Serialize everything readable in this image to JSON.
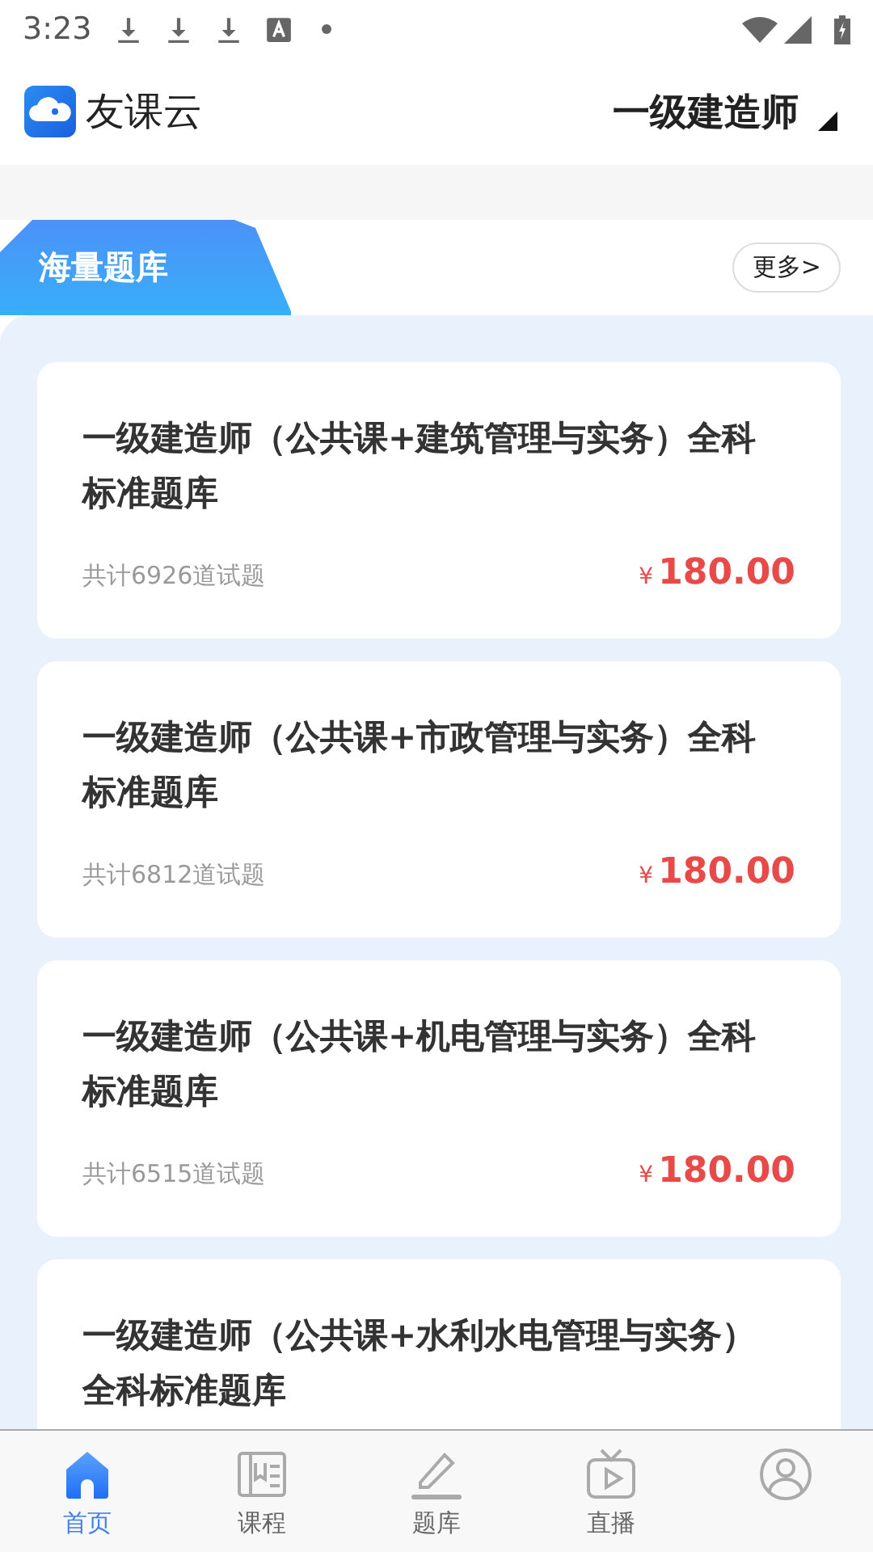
{
  "status_bar": {
    "time": "3:23"
  },
  "header": {
    "app_name": "友课云",
    "category": "一级建造师"
  },
  "section": {
    "title": "海量题库",
    "more": "更多>"
  },
  "items": [
    {
      "title": "一级建造师（公共课+建筑管理与实务）全科标准题库",
      "count": "共计6926道试题",
      "currency": "¥",
      "price": "180.00"
    },
    {
      "title": "一级建造师（公共课+市政管理与实务）全科标准题库",
      "count": "共计6812道试题",
      "currency": "¥",
      "price": "180.00"
    },
    {
      "title": "一级建造师（公共课+机电管理与实务）全科标准题库",
      "count": "共计6515道试题",
      "currency": "¥",
      "price": "180.00"
    },
    {
      "title": "一级建造师（公共课+水利水电管理与实务）全科标准题库"
    }
  ],
  "tabs": [
    {
      "label": "首页",
      "selected": true
    },
    {
      "label": "课程",
      "selected": false
    },
    {
      "label": "题库",
      "selected": false
    },
    {
      "label": "直播",
      "selected": false
    },
    {
      "selected": false
    }
  ]
}
